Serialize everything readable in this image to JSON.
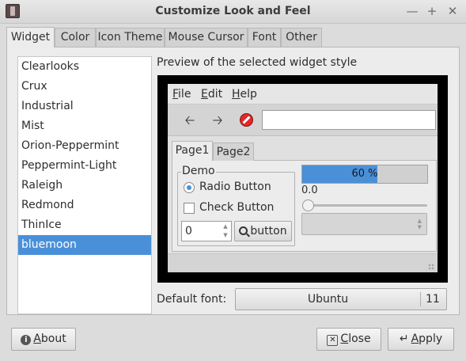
{
  "window": {
    "title": "Customize Look and Feel",
    "controls": {
      "close": "✕",
      "maximize": "+",
      "minimize": "—"
    }
  },
  "tabs": [
    {
      "label": "Widget"
    },
    {
      "label": "Color"
    },
    {
      "label": "Icon Theme"
    },
    {
      "label": "Mouse Cursor"
    },
    {
      "label": "Font"
    },
    {
      "label": "Other"
    }
  ],
  "active_tab": "Widget",
  "themes": {
    "items": [
      "Clearlooks",
      "Crux",
      "Industrial",
      "Mist",
      "Orion-Peppermint",
      "Peppermint-Light",
      "Raleigh",
      "Redmond",
      "ThinIce",
      "bluemoon"
    ],
    "selected": "bluemoon"
  },
  "preview": {
    "label": "Preview of the selected widget style",
    "menu": {
      "file": {
        "mnemonic": "F",
        "rest": "ile"
      },
      "edit": {
        "mnemonic": "E",
        "rest": "dit"
      },
      "help": {
        "mnemonic": "H",
        "rest": "elp"
      }
    },
    "toolbar_icons": [
      "back-arrow-icon",
      "forward-arrow-icon",
      "stop-icon"
    ],
    "tabs": [
      {
        "label": "Page1"
      },
      {
        "label": "Page2"
      }
    ],
    "demo": {
      "legend": "Demo",
      "radio_label": "Radio Button",
      "check_label": "Check Button",
      "spin_value": "0",
      "button_label": "button"
    },
    "progress": {
      "text": "60 %",
      "fraction": 0.6
    },
    "scale": {
      "value": "0.0"
    }
  },
  "default_font": {
    "label": "Default font:",
    "name": "Ubuntu",
    "size": "11"
  },
  "footer": {
    "about": {
      "mnemonic": "A",
      "rest": "bout",
      "icon": "info-icon"
    },
    "close": {
      "mnemonic": "C",
      "rest": "lose",
      "icon": "close-icon"
    },
    "apply": {
      "mnemonic": "A",
      "rest": "pply",
      "icon": "apply-arrow-icon"
    }
  }
}
